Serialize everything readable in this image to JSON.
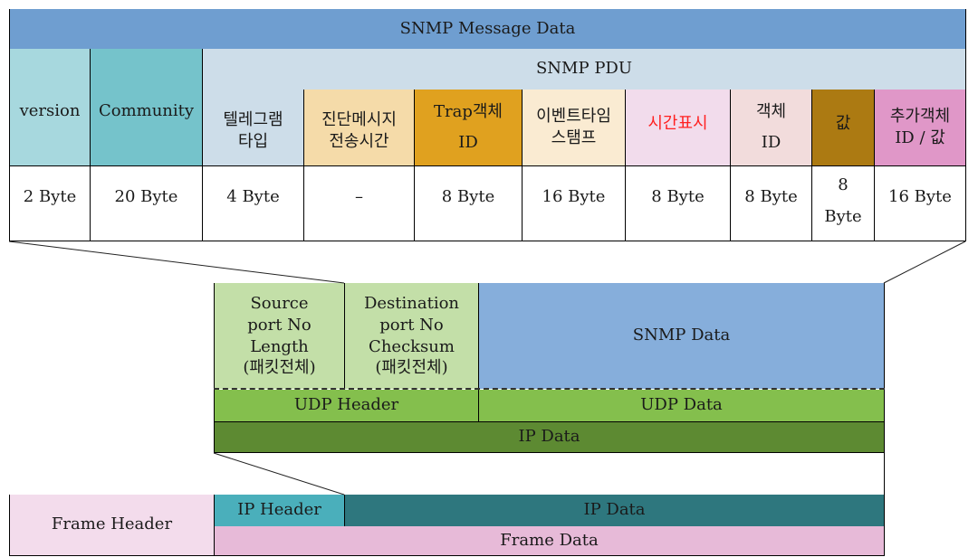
{
  "snmp_message": {
    "title": "SNMP Message Data",
    "pdu_title": "SNMP PDU",
    "fields": [
      {
        "name": "version",
        "size": "2 Byte",
        "color": "#a7d8de"
      },
      {
        "name": "Community",
        "size": "20 Byte",
        "color": "#75c3cb"
      },
      {
        "name": "텔레그램\n타입",
        "size": "4 Byte",
        "color": "#cddde9"
      },
      {
        "name": "진단메시지\n전송시간",
        "size": "–",
        "color": "#f5dba9"
      },
      {
        "name": "Trap객체\nID",
        "size": "8 Byte",
        "color": "#e0a11f"
      },
      {
        "name": "이벤트타임\n스탬프",
        "size": "16 Byte",
        "color": "#faebd2"
      },
      {
        "name": "시간표시",
        "size": "8 Byte",
        "color": "#f2dcec",
        "text_color": "#ff2020"
      },
      {
        "name": "객체\nID",
        "size": "8 Byte",
        "color": "#f2dcdc"
      },
      {
        "name": "값",
        "size": "8\nByte",
        "color": "#ac7a12"
      },
      {
        "name": "추가객체\nID / 값",
        "size": "16 Byte",
        "color": "#e097c8"
      }
    ],
    "colors": {
      "title_bar": "#6f9ed0",
      "pdu_bar": "#cddde9"
    }
  },
  "udp_layer": {
    "source": "Source\nport No\nLength\n(패킷전체)",
    "destination": "Destination\nport No\nChecksum\n(패킷전체)",
    "snmp_data": "SNMP Data",
    "udp_header": "UDP Header",
    "udp_data": "UDP Data",
    "ip_data": "IP Data",
    "colors": {
      "header_fields": "#c3dfa8",
      "snmp_data": "#86aedb",
      "udp": "#84bf4d",
      "ip_data": "#5d8a32"
    }
  },
  "frame_layer": {
    "frame_header": "Frame Header",
    "ip_header": "IP Header",
    "ip_data": "IP Data",
    "frame_data": "Frame Data",
    "colors": {
      "frame_header": "#f3dcec",
      "ip_header": "#4aafbb",
      "ip_data": "#2e777e",
      "frame_data": "#e7bad8"
    }
  }
}
